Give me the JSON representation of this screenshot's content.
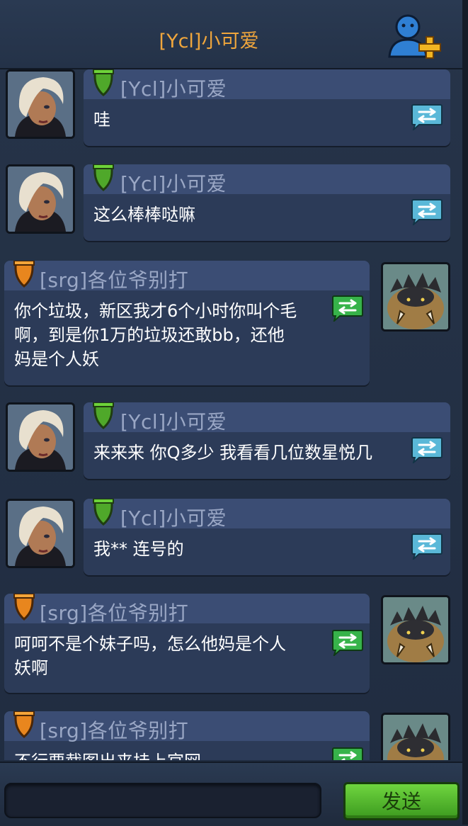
{
  "header": {
    "title": "[Ycl]小可爱"
  },
  "colors": {
    "self_badge": "#4fa82a",
    "other_badge": "#e8861e",
    "translate_self": "#5ab8d8",
    "translate_other": "#37b34a",
    "send_button": "#5cc230"
  },
  "messages": [
    {
      "side": "left",
      "sender": "[Ycl]小可爱",
      "text": "哇",
      "avatar": "blonde-woman-avatar"
    },
    {
      "side": "left",
      "sender": "[Ycl]小可爱",
      "text": "这么棒棒哒嘛",
      "avatar": "blonde-woman-avatar"
    },
    {
      "side": "right",
      "sender": "[srg]各位爷别打",
      "text": "你个垃圾，新区我才6个小时你叫个毛\n啊，到是你1万的垃圾还敢bb，还他\n妈是个人妖",
      "avatar": "beast-warrior-avatar"
    },
    {
      "side": "left",
      "sender": "[Ycl]小可爱",
      "text": "来来来 你Q多少 我看看几位数星悦几",
      "avatar": "blonde-woman-avatar"
    },
    {
      "side": "left",
      "sender": "[Ycl]小可爱",
      "text": "我** 连号的",
      "avatar": "blonde-woman-avatar"
    },
    {
      "side": "right",
      "sender": "[srg]各位爷别打",
      "text": "呵呵不是个妹子吗，怎么他妈是个人\n妖啊",
      "avatar": "beast-warrior-avatar"
    },
    {
      "side": "right",
      "sender": "[srg]各位爷别打",
      "text": "不行要截图出来挂上官网",
      "avatar": "beast-warrior-avatar"
    }
  ],
  "input": {
    "placeholder": "",
    "value": ""
  },
  "send": {
    "label": "发送"
  },
  "icons": {
    "add_friend": "add-friend-icon",
    "translate": "translate-icon"
  }
}
